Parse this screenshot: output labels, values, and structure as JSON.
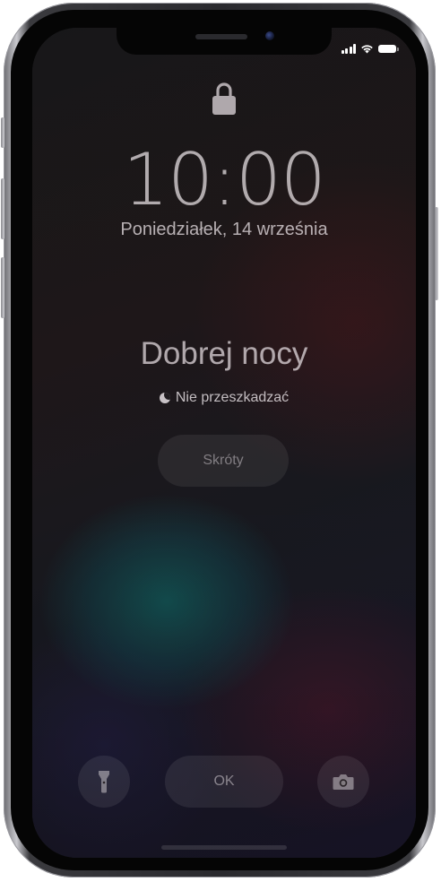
{
  "lock_screen": {
    "time": "10:00",
    "date": "Poniedziałek, 14 września",
    "greeting": "Dobrej nocy",
    "dnd_label": "Nie przeszkadzać",
    "shortcuts_label": "Skróty",
    "ok_label": "OK"
  },
  "status_bar": {
    "signal_icon": "cellular-signal-icon",
    "wifi_icon": "wifi-icon",
    "battery_icon": "battery-icon"
  },
  "icons": {
    "lock": "lock-icon",
    "moon": "moon-icon",
    "flashlight": "flashlight-icon",
    "camera": "camera-icon"
  },
  "colors": {
    "text_primary": "#ebe4e8",
    "wallpaper_teal": "#145f5f",
    "wallpaper_red": "#5a192d",
    "wallpaper_purple": "#282350"
  }
}
